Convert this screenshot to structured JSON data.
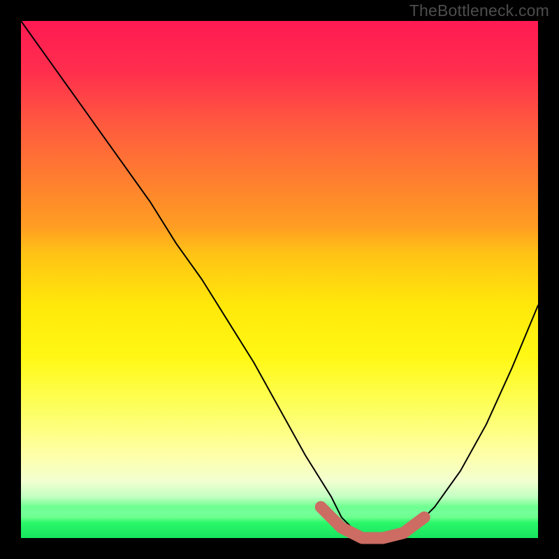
{
  "watermark": "TheBottleneck.com",
  "colors": {
    "frame": "#000000",
    "watermark": "#4d4d4d",
    "curve": "#000000",
    "accent": "#cc6c63",
    "gradient_stops": [
      "#ff1a53",
      "#ff2f4d",
      "#ff5a3f",
      "#ff7c30",
      "#ff9e22",
      "#ffc315",
      "#ffe80a",
      "#fff814",
      "#fdff60",
      "#feffa9",
      "#f2ffd0",
      "#c3ffc3",
      "#6cff8e",
      "#76ff9c",
      "#6cff8e",
      "#2cf76a",
      "#17e45e"
    ]
  },
  "chart_data": {
    "type": "line",
    "title": "",
    "xlabel": "",
    "ylabel": "",
    "xlim": [
      0,
      100
    ],
    "ylim": [
      0,
      100
    ],
    "series": [
      {
        "name": "bottleneck-curve",
        "x": [
          0,
          5,
          10,
          15,
          20,
          25,
          30,
          35,
          40,
          45,
          50,
          55,
          60,
          62,
          64,
          68,
          72,
          76,
          80,
          85,
          90,
          95,
          100
        ],
        "y": [
          100,
          93,
          86,
          79,
          72,
          65,
          57,
          50,
          42,
          34,
          25,
          16,
          8,
          4,
          2,
          0,
          0,
          2,
          6,
          13,
          22,
          33,
          45
        ]
      }
    ],
    "highlight": {
      "name": "optimal-range",
      "x": [
        58,
        62,
        66,
        70,
        74,
        78
      ],
      "y": [
        6,
        2,
        0,
        0,
        1,
        4
      ]
    }
  }
}
